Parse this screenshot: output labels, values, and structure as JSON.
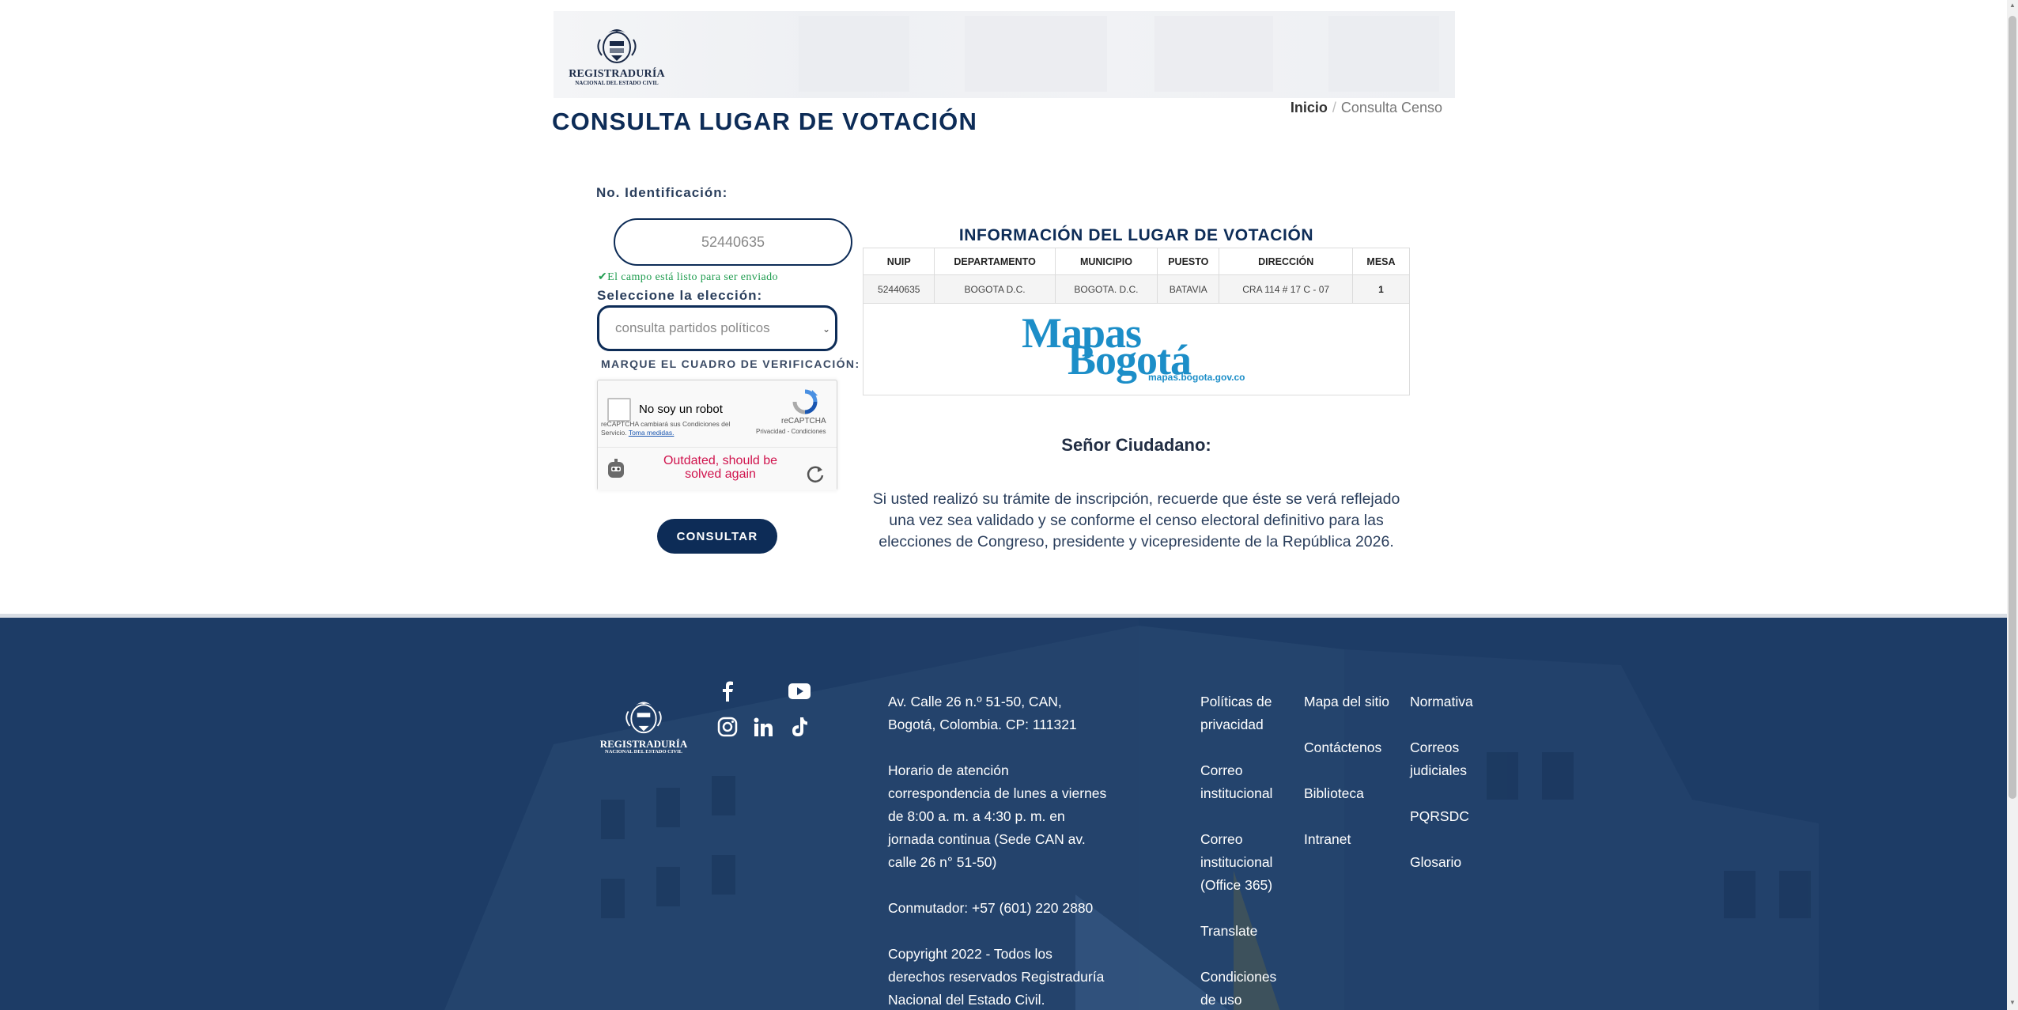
{
  "header": {
    "logo": {
      "name": "REGISTRADURÍA",
      "sub": "NACIONAL DEL ESTADO CIVIL"
    },
    "breadcrumb": {
      "home": "Inicio",
      "separator": "/",
      "current": "Consulta Censo"
    },
    "title": "CONSULTA LUGAR DE VOTACIÓN"
  },
  "form": {
    "id_label": "No. Identificación:",
    "id_value": "52440635",
    "valid_message": "✔El campo está listo para ser enviado",
    "election_label": "Seleccione la elección:",
    "election_selected": "consulta partidos políticos",
    "verify_label": "MARQUE EL CUADRO DE VERIFICACIÓN:",
    "submit_label": "CONSULTAR"
  },
  "captcha": {
    "checkbox_label": "No soy un robot",
    "brand": "reCAPTCHA",
    "links": "Privacidad - Condiciones",
    "terms_text": "reCAPTCHA cambiará sus Condiciones del Servicio.",
    "terms_link": "Toma medidas.",
    "error": "Outdated, should be solved again"
  },
  "result": {
    "title": "INFORMACIÓN DEL LUGAR DE VOTACIÓN",
    "columns": [
      "NUIP",
      "DEPARTAMENTO",
      "MUNICIPIO",
      "PUESTO",
      "DIRECCIÓN",
      "MESA"
    ],
    "row": [
      "52440635",
      "BOGOTA D.C.",
      "BOGOTA. D.C.",
      "BATAVIA",
      "CRA 114 # 17 C - 07",
      "1"
    ],
    "map_logo": {
      "line1": "Mapas",
      "line2": "Bogotá",
      "url": "mapas.bogota.gov.co"
    }
  },
  "notice": {
    "greeting": "Señor Ciudadano:",
    "text": "Si usted realizó su trámite de inscripción, recuerde que éste se verá reflejado una vez sea validado y se conforme el censo electoral definitivo para las elecciones de Congreso, presidente y vicepresidente de la República 2026."
  },
  "footer": {
    "logo": {
      "name": "REGISTRADURÍA",
      "sub": "NACIONAL DEL ESTADO CIVIL"
    },
    "address": "Av. Calle 26 n.º 51-50, CAN, Bogotá, Colombia. CP: 111321",
    "hours": " Horario de atención correspondencia de lunes a viernes de 8:00 a. m. a 4:30 p. m. en jornada continua (Sede CAN av. calle 26 n° 51-50)",
    "phone": " Conmutador: +57 (601) 220 2880",
    "copyright": " Copyright 2022 - Todos los derechos reservados Registraduría Nacional del Estado Civil.",
    "col1": [
      "Políticas de privacidad",
      "Correo institucional",
      "Correo institucional (Office 365)",
      "Translate",
      "Condiciones de uso"
    ],
    "col2": [
      "Mapa del sitio",
      "Contáctenos",
      "Biblioteca",
      "Intranet"
    ],
    "col3": [
      "Normativa",
      "Correos judiciales",
      "PQRSDC",
      "Glosario"
    ],
    "social": [
      "facebook-icon",
      "youtube-icon",
      "instagram-icon",
      "linkedin-icon",
      "tiktok-icon"
    ]
  },
  "colors": {
    "primary": "#0d2c57",
    "footer": "#1d3c66",
    "valid": "#1f9c4f",
    "error": "#d0134d",
    "map_blue": "#1c8ec8"
  }
}
